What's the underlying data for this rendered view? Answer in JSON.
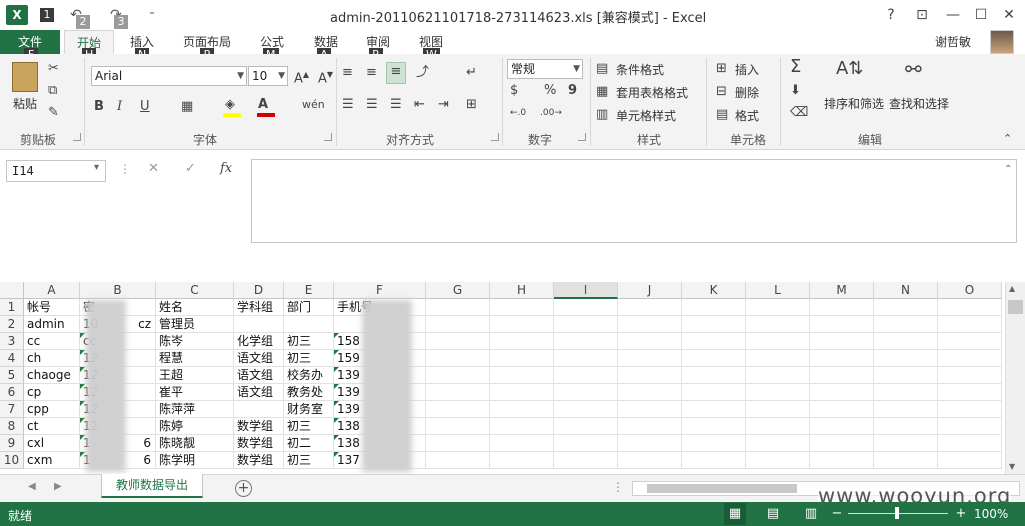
{
  "window": {
    "title": "admin-20110621101718-273114623.xls  [兼容模式] - Excel",
    "help": "?",
    "ribbon_display": "⊡",
    "minimize": "—",
    "maximize": "☐",
    "close": "✕"
  },
  "qat": {
    "logo": "X",
    "save_key": "1",
    "undo_key": "2",
    "redo_key": "3",
    "more": "⁼"
  },
  "user": {
    "name": "谢哲敏"
  },
  "tabs": [
    {
      "label": "文件",
      "key": "F"
    },
    {
      "label": "开始",
      "key": "H"
    },
    {
      "label": "插入",
      "key": "N"
    },
    {
      "label": "页面布局",
      "key": "P"
    },
    {
      "label": "公式",
      "key": "M"
    },
    {
      "label": "数据",
      "key": "A"
    },
    {
      "label": "审阅",
      "key": "R"
    },
    {
      "label": "视图",
      "key": "W"
    }
  ],
  "ribbon": {
    "groups": [
      "剪贴板",
      "字体",
      "对齐方式",
      "数字",
      "样式",
      "单元格",
      "编辑"
    ],
    "paste": "粘贴",
    "font_name": "Arial",
    "font_size": "10",
    "bold": "B",
    "italic": "I",
    "underline": "U",
    "number_format": "常规",
    "percent": "%",
    "comma": "9",
    "cond_format": "条件格式",
    "table_format": "套用表格格式",
    "cell_style": "单元格样式",
    "insert": "插入",
    "delete": "删除",
    "format": "格式",
    "sort_filter": "排序和筛选",
    "find_select": "查找和选择",
    "font_color": "#d40000",
    "fill_color": "#ffff00"
  },
  "formula_bar": {
    "name_box": "I14",
    "fx": "fx",
    "cancel": "✕",
    "enter": "✓",
    "value": ""
  },
  "columns": [
    "A",
    "B",
    "C",
    "D",
    "E",
    "F",
    "G",
    "H",
    "I",
    "J",
    "K",
    "L",
    "M",
    "N",
    "O"
  ],
  "selected_column": "I",
  "rows": [
    {
      "n": "1",
      "A": "帐号",
      "B": "密",
      "C": "姓名",
      "D": "学科组",
      "E": "部门",
      "F": "手机号"
    },
    {
      "n": "2",
      "A": "admin",
      "B": "10",
      "B2": "cz",
      "C": "管理员",
      "D": "",
      "E": "",
      "F": ""
    },
    {
      "n": "3",
      "A": "cc",
      "B": "cc",
      "C": "陈岑",
      "D": "化学组",
      "E": "初三",
      "F": "158"
    },
    {
      "n": "4",
      "A": "ch",
      "B": "12",
      "C": "程慧",
      "D": "语文组",
      "E": "初三",
      "F": "159"
    },
    {
      "n": "5",
      "A": "chaoge",
      "B": "12",
      "C": "王超",
      "D": "语文组",
      "E": "校务办",
      "F": "139"
    },
    {
      "n": "6",
      "A": "cp",
      "B": "12",
      "C": "崔平",
      "D": "语文组",
      "E": "教务处",
      "F": "139"
    },
    {
      "n": "7",
      "A": "cpp",
      "B": "12",
      "C": "陈萍萍",
      "D": "",
      "E": "财务室",
      "F": "139"
    },
    {
      "n": "8",
      "A": "ct",
      "B": "12",
      "C": "陈婷",
      "D": "数学组",
      "E": "初三",
      "F": "138"
    },
    {
      "n": "9",
      "A": "cxl",
      "B": "1",
      "B2": "6",
      "C": "陈晓靓",
      "D": "数学组",
      "E": "初二",
      "F": "138"
    },
    {
      "n": "10",
      "A": "cxm",
      "B": "1",
      "B2": "6",
      "C": "陈学明",
      "D": "数学组",
      "E": "初三",
      "F": "137"
    }
  ],
  "sheet": {
    "tab": "教师数据导出",
    "add": "+"
  },
  "status": {
    "text": "就绪",
    "zoom": "100%",
    "zoom_minus": "−",
    "zoom_plus": "+"
  },
  "watermark": "www.wooyun.org"
}
